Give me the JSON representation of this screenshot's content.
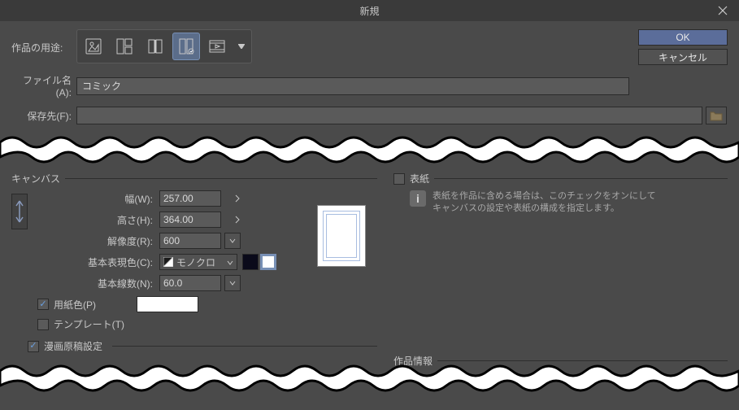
{
  "title": "新規",
  "buttons": {
    "ok": "OK",
    "cancel": "キャンセル"
  },
  "labels": {
    "purpose": "作品の用途:",
    "filename": "ファイル名(A):",
    "saveto": "保存先(F):"
  },
  "filename_value": "コミック",
  "canvas": {
    "group_title": "キャンバス",
    "width_label": "幅(W):",
    "width_value": "257.00",
    "height_label": "高さ(H):",
    "height_value": "364.00",
    "resolution_label": "解像度(R):",
    "resolution_value": "600",
    "colormode_label": "基本表現色(C):",
    "colormode_value": "モノクロ",
    "lines_label": "基本線数(N):",
    "lines_value": "60.0",
    "paper_color_label": "用紙色(P)",
    "template_label": "テンプレート(T)"
  },
  "cover": {
    "group_title": "表紙",
    "info_line1": "表紙を作品に含める場合は、このチェックをオンにして",
    "info_line2": "キャンバスの設定や表紙の構成を指定します。"
  },
  "manga_settings_label": "漫画原稿設定",
  "work_info_title": "作品情報"
}
